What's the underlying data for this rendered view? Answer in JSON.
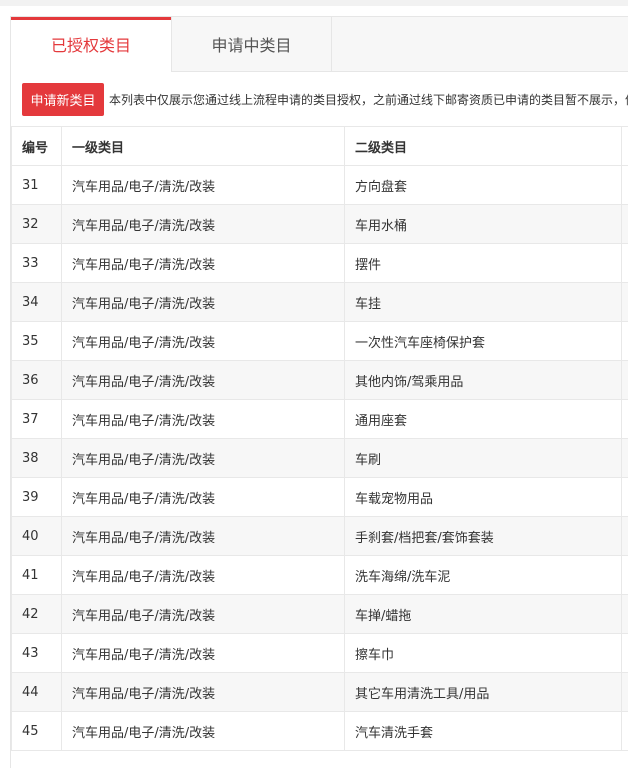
{
  "tabs": [
    {
      "label": "已授权类目",
      "active": true
    },
    {
      "label": "申请中类目",
      "active": false
    }
  ],
  "toolbar": {
    "apply_label": "申请新类目",
    "notice": "本列表中仅展示您通过线上流程申请的类目授权，之前通过线下邮寄资质已申请的类目暂不展示，值"
  },
  "table": {
    "headers": [
      "编号",
      "一级类目",
      "二级类目",
      ""
    ],
    "rows": [
      {
        "id": "31",
        "level1": "汽车用品/电子/清洗/改装",
        "level2": "方向盘套"
      },
      {
        "id": "32",
        "level1": "汽车用品/电子/清洗/改装",
        "level2": "车用水桶"
      },
      {
        "id": "33",
        "level1": "汽车用品/电子/清洗/改装",
        "level2": "摆件"
      },
      {
        "id": "34",
        "level1": "汽车用品/电子/清洗/改装",
        "level2": "车挂"
      },
      {
        "id": "35",
        "level1": "汽车用品/电子/清洗/改装",
        "level2": "一次性汽车座椅保护套"
      },
      {
        "id": "36",
        "level1": "汽车用品/电子/清洗/改装",
        "level2": "其他内饰/驾乘用品"
      },
      {
        "id": "37",
        "level1": "汽车用品/电子/清洗/改装",
        "level2": "通用座套"
      },
      {
        "id": "38",
        "level1": "汽车用品/电子/清洗/改装",
        "level2": "车刷"
      },
      {
        "id": "39",
        "level1": "汽车用品/电子/清洗/改装",
        "level2": "车载宠物用品"
      },
      {
        "id": "40",
        "level1": "汽车用品/电子/清洗/改装",
        "level2": "手刹套/档把套/套饰套装"
      },
      {
        "id": "41",
        "level1": "汽车用品/电子/清洗/改装",
        "level2": "洗车海绵/洗车泥"
      },
      {
        "id": "42",
        "level1": "汽车用品/电子/清洗/改装",
        "level2": "车掸/蜡拖"
      },
      {
        "id": "43",
        "level1": "汽车用品/电子/清洗/改装",
        "level2": "擦车巾"
      },
      {
        "id": "44",
        "level1": "汽车用品/电子/清洗/改装",
        "level2": "其它车用清洗工具/用品"
      },
      {
        "id": "45",
        "level1": "汽车用品/电子/清洗/改装",
        "level2": "汽车清洗手套"
      }
    ]
  },
  "colors": {
    "accent": "#e4393c",
    "border": "#e8e8e8",
    "stripe": "#f7f7f7"
  }
}
